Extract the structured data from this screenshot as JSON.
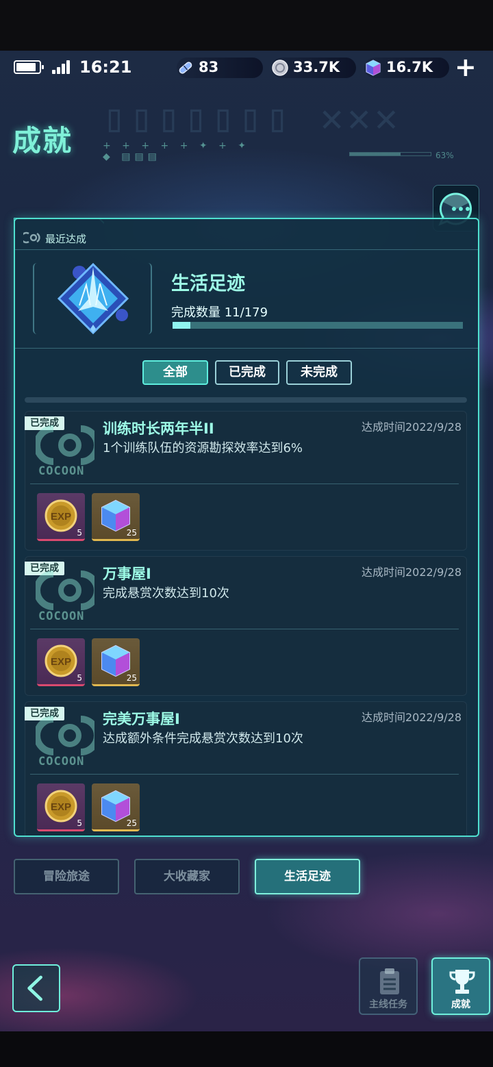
{
  "status_bar": {
    "time": "16:21"
  },
  "resources": [
    {
      "icon": "stamina-icon",
      "value": "83"
    },
    {
      "icon": "coin-icon",
      "value": "33.7K"
    },
    {
      "icon": "gem-cube-icon",
      "value": "16.7K"
    }
  ],
  "header": {
    "title": "成就",
    "progress_pct": "63%",
    "progress": 0.63
  },
  "recent": {
    "label": "最近达成",
    "category": "生活足迹",
    "count_label": "完成数量 11/179",
    "completed": 11,
    "total": 179
  },
  "filters": [
    {
      "label": "全部",
      "active": true
    },
    {
      "label": "已完成",
      "active": false
    },
    {
      "label": "未完成",
      "active": false
    }
  ],
  "achievements": [
    {
      "tag": "已完成",
      "logo_text": "COCOON",
      "title": "训练时长两年半II",
      "desc": "1个训练队伍的资源勘探效率达到6%",
      "date": "达成时间2022/9/28",
      "rewards": [
        {
          "icon": "exp-coin-icon",
          "qty": "5"
        },
        {
          "icon": "gem-cube-icon",
          "qty": "25"
        }
      ]
    },
    {
      "tag": "已完成",
      "logo_text": "COCOON",
      "title": "万事屋I",
      "desc": "完成悬赏次数达到10次",
      "date": "达成时间2022/9/28",
      "rewards": [
        {
          "icon": "exp-coin-icon",
          "qty": "5"
        },
        {
          "icon": "gem-cube-icon",
          "qty": "25"
        }
      ]
    },
    {
      "tag": "已完成",
      "logo_text": "COCOON",
      "title": "完美万事屋I",
      "desc": "达成额外条件完成悬赏次数达到10次",
      "date": "达成时间2022/9/28",
      "rewards": [
        {
          "icon": "exp-coin-icon",
          "qty": "5"
        },
        {
          "icon": "gem-cube-icon",
          "qty": "25"
        }
      ]
    }
  ],
  "category_tabs": [
    {
      "label": "冒险旅途",
      "active": false
    },
    {
      "label": "大收藏家",
      "active": false
    },
    {
      "label": "生活足迹",
      "active": true
    }
  ],
  "nav": {
    "main_quest": "主线任务",
    "achievements": "成就"
  },
  "colors": {
    "accent": "#4fe0d0",
    "title_green": "#9dfbe6",
    "active_tab": "#25707a"
  }
}
